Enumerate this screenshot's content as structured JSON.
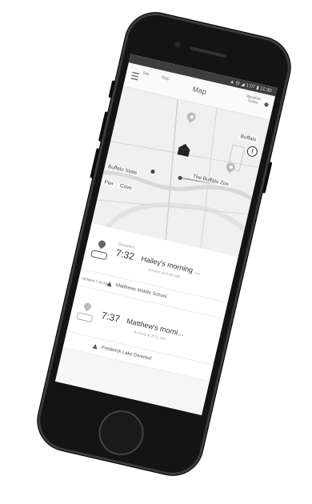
{
  "status_bar": {
    "text": "▲ ⊟ ◢ 1:07 ▮ 11:30"
  },
  "app_bar": {
    "title": "Map",
    "chip_left_1": "Site",
    "chip_left_2": "Stop",
    "chip_right": "Weather Today"
  },
  "map": {
    "labels": {
      "buffalo_state": "Buffalo State",
      "buffalo_zoo": "The Buffalo Zoo",
      "pier": "Pier",
      "cove": "Cove",
      "buffalo_corner": "Buffalo"
    }
  },
  "routes": [
    {
      "status": "Departed",
      "time": "7:32",
      "name": "Hailey's morning ...",
      "sub": "Arrives at 8:06 AM"
    },
    {
      "status": "",
      "time": "7:37",
      "name": "Matthew's morni...",
      "sub": "Arrives at 8:11 AM"
    }
  ],
  "alerts": [
    {
      "side": "Updated 7:31 AM",
      "text": "Matthews Middle School"
    },
    {
      "side": "",
      "text": "Frederick Lake Diverted"
    }
  ]
}
